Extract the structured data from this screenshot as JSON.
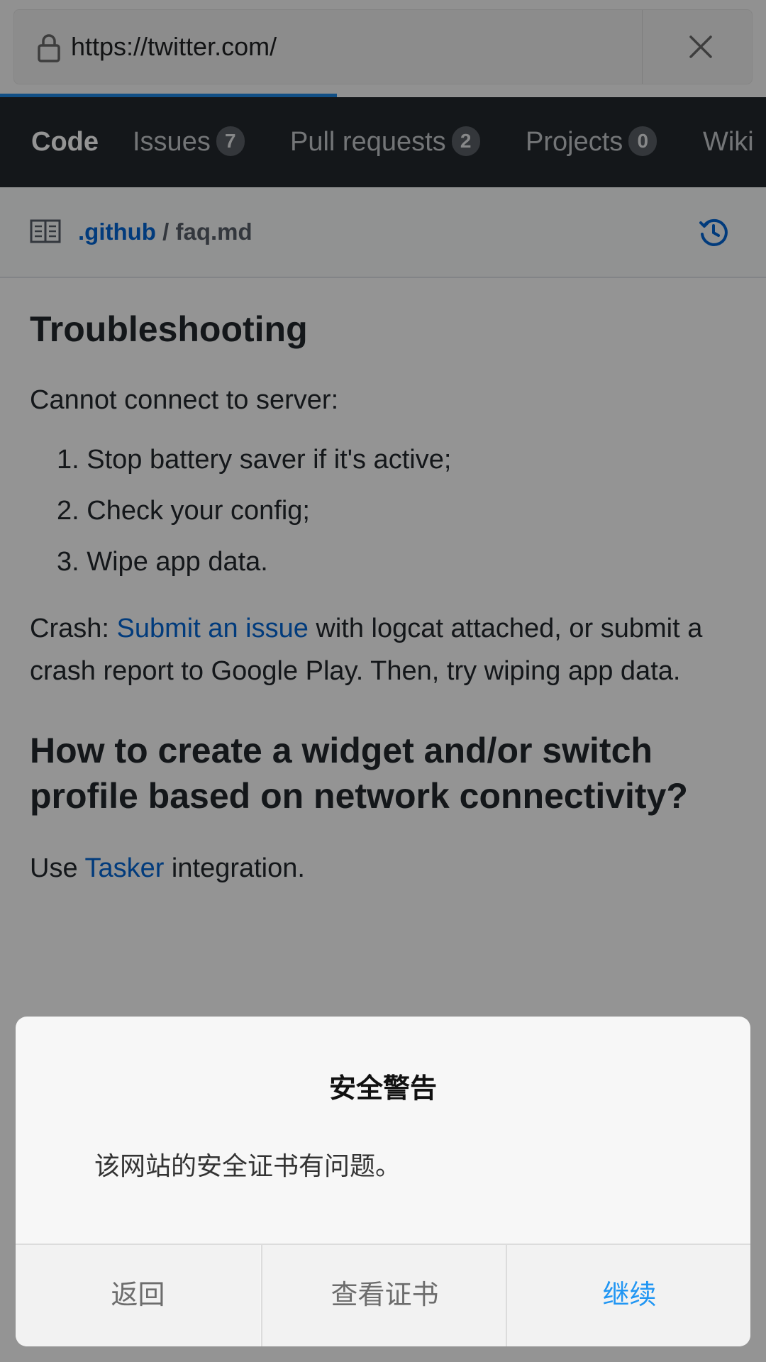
{
  "browser": {
    "url": "https://twitter.com/",
    "load_progress_percent": 44
  },
  "repo_nav": {
    "tabs": [
      {
        "label": "Code",
        "count": null,
        "active": true
      },
      {
        "label": "Issues",
        "count": "7"
      },
      {
        "label": "Pull requests",
        "count": "2"
      },
      {
        "label": "Projects",
        "count": "0"
      },
      {
        "label": "Wiki",
        "count": null
      }
    ]
  },
  "file_header": {
    "dir": ".github",
    "separator": "/",
    "file": "faq.md"
  },
  "content": {
    "heading1": "Troubleshooting",
    "para1": "Cannot connect to server:",
    "steps": [
      "1. Stop battery saver if it's active;",
      "2. Check your config;",
      "3. Wipe app data."
    ],
    "crash_prefix": "Crash: ",
    "crash_link": "Submit an issue",
    "crash_rest": " with logcat attached, or submit a crash report to Google Play. Then, try wiping app data.",
    "heading2": "How to create a widget and/or switch profile based on network connectivity?",
    "use_prefix": "Use ",
    "use_link": "Tasker",
    "use_rest": " integration."
  },
  "dialog": {
    "title": "安全警告",
    "message": "该网站的安全证书有问题。",
    "buttons": {
      "back": "返回",
      "view_cert": "查看证书",
      "continue": "继续"
    }
  },
  "colors": {
    "accent": "#0366d6",
    "nav_bg": "#24292e",
    "dialog_continue": "#2196f3",
    "progress": "#1e88e5"
  },
  "icons": [
    "lock-icon",
    "close-icon",
    "book-icon",
    "history-icon"
  ]
}
